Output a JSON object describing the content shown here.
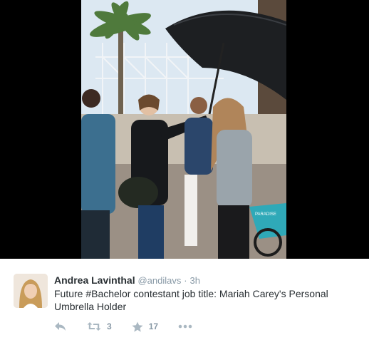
{
  "media": {
    "photo_name": "paparazzi-umbrella-photo",
    "bike_sign_text": "PARADISE"
  },
  "tweet": {
    "author_name": "Andrea Lavinthal",
    "author_handle": "@andilavs",
    "separator": "·",
    "timestamp": "3h",
    "text": "Future #Bachelor contestant job title: Mariah Carey's Personal Umbrella Holder",
    "actions": {
      "reply_icon": "reply-icon",
      "retweet_icon": "retweet-icon",
      "retweet_count": "3",
      "favorite_icon": "star-icon",
      "favorite_count": "17",
      "more_icon": "more-icon"
    }
  },
  "colors": {
    "text": "#292f33",
    "muted": "#8899a6",
    "icon": "#aab8c2",
    "background": "#ffffff",
    "media_background": "#000000"
  }
}
